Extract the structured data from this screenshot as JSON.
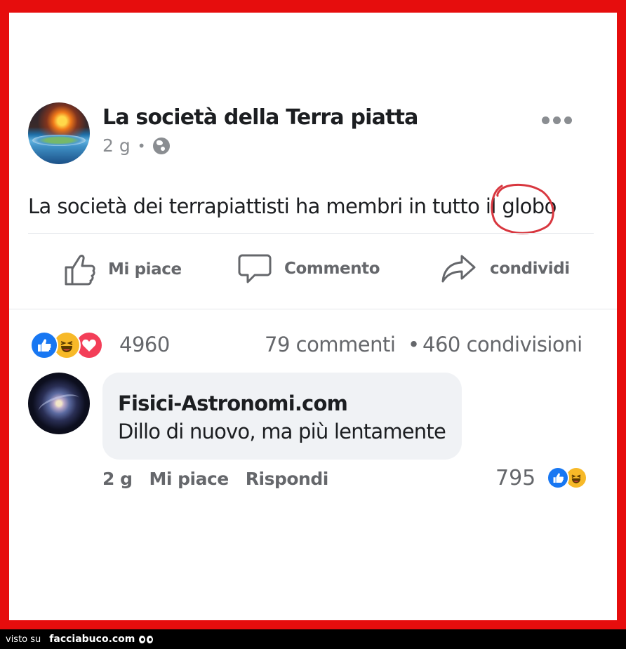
{
  "post": {
    "page_name": "La società della Terra piatta",
    "time": "2 g",
    "separator": "•",
    "visibility_icon": "globe-icon",
    "more_icon": "more-options-icon",
    "text": "La società dei terrapiattisti ha membri in tutto il globo"
  },
  "actions": {
    "like_label": "Mi piace",
    "comment_label": "Commento",
    "share_label": "condividi"
  },
  "stats": {
    "reactions": [
      "like",
      "haha",
      "love"
    ],
    "reaction_count": "4960",
    "comments": "79 commenti",
    "separator": "•",
    "shares": "460 condivisioni"
  },
  "comment": {
    "author": "Fisici-Astronomi.com",
    "text": "Dillo di nuovo, ma più lentamente",
    "time": "2 g",
    "like_label": "Mi piace",
    "reply_label": "Rispondi",
    "reaction_count": "795",
    "reactions": [
      "like",
      "haha"
    ]
  },
  "footer": {
    "visto_su": "visto su",
    "site": "facciabuco.com"
  },
  "colors": {
    "frame": "#e60d0d",
    "text": "#1c1e21",
    "muted": "#65676b",
    "like": "#1877f2",
    "haha": "#f7b928",
    "love": "#f33e58",
    "annotation_circle": "#d8373f"
  }
}
